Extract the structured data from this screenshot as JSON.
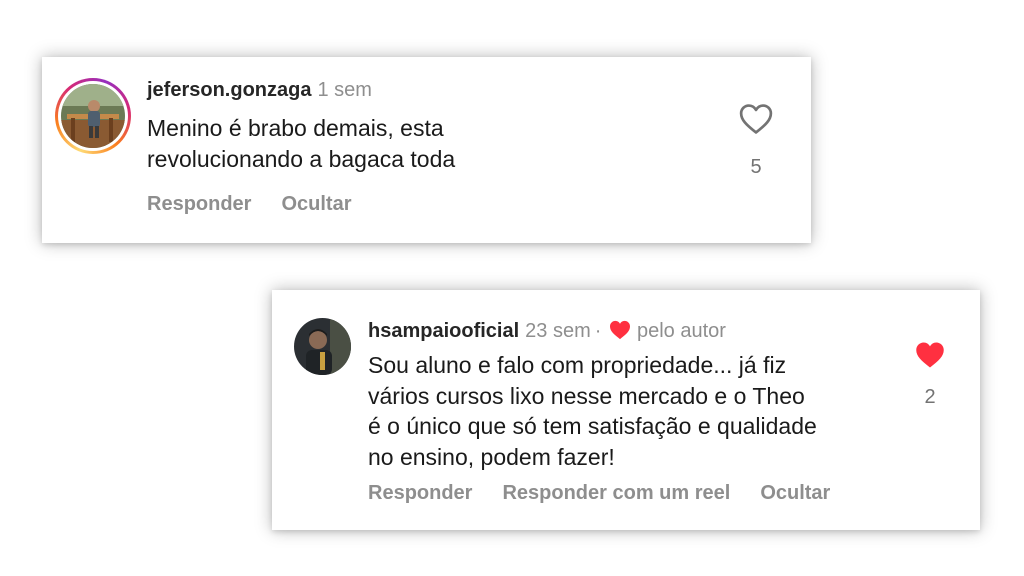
{
  "comments": [
    {
      "username": "jeferson.gonzaga",
      "time": "1 sem",
      "text_lines": [
        "Menino é brabo demais, esta",
        "revolucionando a bagaca toda"
      ],
      "likes": "5",
      "liked": false,
      "has_story_ring": true,
      "actions": [
        "Responder",
        "Ocultar"
      ]
    },
    {
      "username": "hsampaiooficial",
      "time": "23 sem",
      "separator": "·",
      "author_liked_label": "pelo autor",
      "text_lines": [
        "Sou aluno e falo com propriedade... já fiz",
        "vários cursos lixo nesse mercado e o Theo",
        "é o único que só tem satisfação e qualidade",
        "no ensino, podem fazer!"
      ],
      "likes": "2",
      "liked": true,
      "has_story_ring": false,
      "actions": [
        "Responder",
        "Responder com um reel",
        "Ocultar"
      ]
    }
  ],
  "colors": {
    "heart_red": "#ff3040",
    "muted_text": "#8e8e8e",
    "text": "#262626"
  },
  "icons": {
    "like_outline": "heart-outline-icon",
    "like_filled": "heart-filled-icon"
  }
}
